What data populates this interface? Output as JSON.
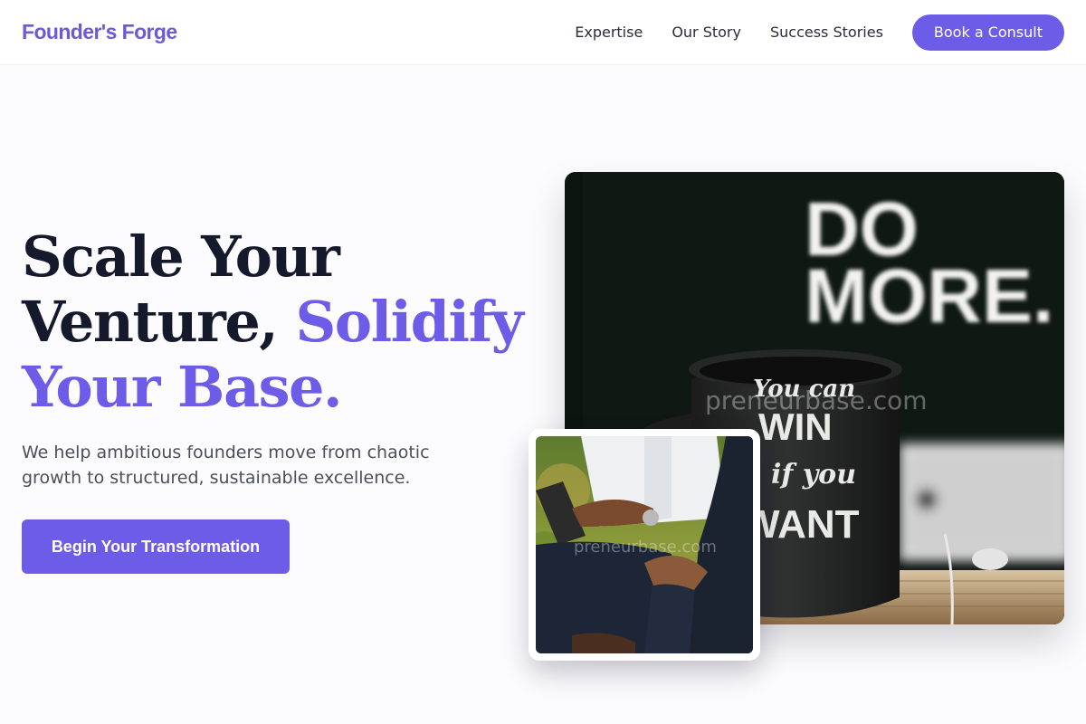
{
  "header": {
    "logo": "Founder's Forge",
    "nav": [
      "Expertise",
      "Our Story",
      "Success Stories"
    ],
    "cta": "Book a Consult"
  },
  "hero": {
    "title_line1": "Scale Your",
    "title_line2_plain": "Venture, ",
    "title_line2_accent": "Solidify",
    "title_line3_accent": "Your Base.",
    "subtitle": "We help ambitious founders move from chaotic growth to structured, sustainable excellence.",
    "cta": "Begin Your Transformation"
  },
  "images": {
    "main": {
      "sign_line1": "DO",
      "sign_line2": "MORE.",
      "mug_line1": "You can",
      "mug_line2": "WIN",
      "mug_line3": "if you",
      "mug_line4": "WANT",
      "watermark": "preneurbase.com"
    },
    "secondary": {
      "watermark": "preneurbase.com"
    }
  },
  "colors": {
    "accent": "#6c5ce7",
    "text_dark": "#141a2b",
    "text_muted": "#4a4f5c"
  }
}
